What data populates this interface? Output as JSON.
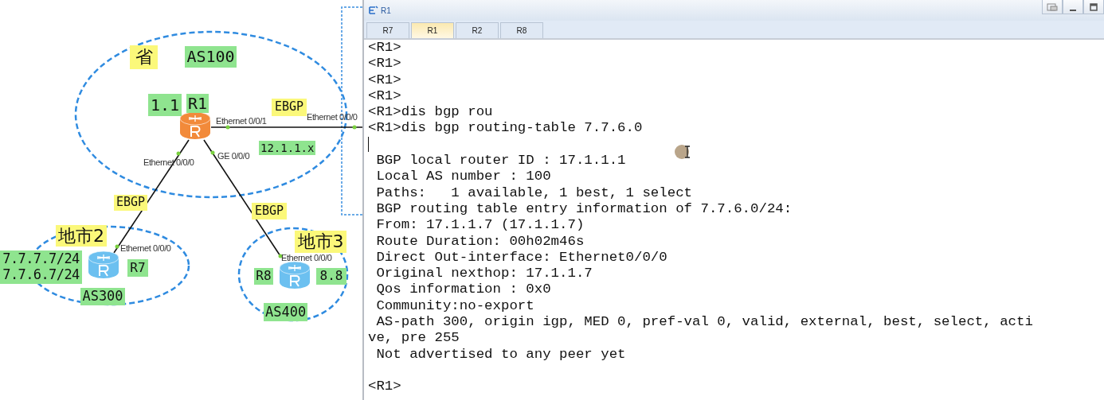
{
  "diagram": {
    "labels": [
      {
        "kind": "area",
        "text": "省"
      },
      {
        "kind": "as",
        "text": "AS100"
      },
      {
        "kind": "as",
        "text": "1.1"
      },
      {
        "kind": "as",
        "text": "R1"
      },
      {
        "kind": "session",
        "text": "EBGP"
      },
      {
        "kind": "port",
        "text": "Ethernet 0/0/1"
      },
      {
        "kind": "port",
        "text": "Ethernet 0/0/0"
      },
      {
        "kind": "as",
        "text": "12.1.1.x"
      },
      {
        "kind": "port",
        "text": "Ethernet 0/0/0"
      },
      {
        "kind": "port",
        "text": "GE 0/0/0"
      },
      {
        "kind": "session",
        "text": "EBGP"
      },
      {
        "kind": "session",
        "text": "EBGP"
      },
      {
        "kind": "area",
        "text": "地市2"
      },
      {
        "kind": "port",
        "text": "Ethernet 0/0/0"
      },
      {
        "kind": "as",
        "text": "7.7.7.7/24\n7.7.6.7/24"
      },
      {
        "kind": "as",
        "text": "R7"
      },
      {
        "kind": "as",
        "text": "AS300"
      },
      {
        "kind": "area",
        "text": "地市3"
      },
      {
        "kind": "port",
        "text": "Ethernet 0/0/0"
      },
      {
        "kind": "as",
        "text": "R8"
      },
      {
        "kind": "as",
        "text": "8.8"
      },
      {
        "kind": "as",
        "text": "AS400"
      }
    ],
    "routers": [
      {
        "color": "#f28a3a"
      },
      {
        "color": "#6cc0f0"
      },
      {
        "color": "#6cc0f0"
      }
    ]
  },
  "window": {
    "title": "R1"
  },
  "tabs": [
    {
      "label": "R7",
      "selected": false
    },
    {
      "label": "R1",
      "selected": true
    },
    {
      "label": "R2",
      "selected": false
    },
    {
      "label": "R8",
      "selected": false
    }
  ],
  "terminal": {
    "lines": [
      {
        "kind": "text",
        "text": "<R1>"
      },
      {
        "kind": "text",
        "text": "<R1>"
      },
      {
        "kind": "text",
        "text": "<R1>"
      },
      {
        "kind": "text",
        "text": "<R1>"
      },
      {
        "kind": "text",
        "text": "<R1>dis bgp rou"
      },
      {
        "kind": "text",
        "text": "<R1>dis bgp routing-table 7.7.6.0"
      },
      {
        "kind": "cursor"
      },
      {
        "kind": "text",
        "text": " BGP local router ID : 17.1.1.1"
      },
      {
        "kind": "text",
        "text": " Local AS number : 100"
      },
      {
        "kind": "text",
        "text": " Paths:   1 available, 1 best, 1 select"
      },
      {
        "kind": "text",
        "text": " BGP routing table entry information of 7.7.6.0/24:"
      },
      {
        "kind": "text",
        "text": " From: 17.1.1.7 (17.1.1.7)"
      },
      {
        "kind": "text",
        "text": " Route Duration: 00h02m46s"
      },
      {
        "kind": "text",
        "text": " Direct Out-interface: Ethernet0/0/0"
      },
      {
        "kind": "text",
        "text": " Original nexthop: 17.1.1.7"
      },
      {
        "kind": "text",
        "text": " Qos information : 0x0"
      },
      {
        "kind": "text",
        "text": " Community:no-export"
      },
      {
        "kind": "text",
        "text": " AS-path 300, origin igp, MED 0, pref-val 0, valid, external, best, select, acti"
      },
      {
        "kind": "text",
        "text": "ve, pre 255"
      },
      {
        "kind": "text",
        "text": " Not advertised to any peer yet"
      },
      {
        "kind": "blank"
      },
      {
        "kind": "text",
        "text": "<R1>"
      }
    ]
  }
}
